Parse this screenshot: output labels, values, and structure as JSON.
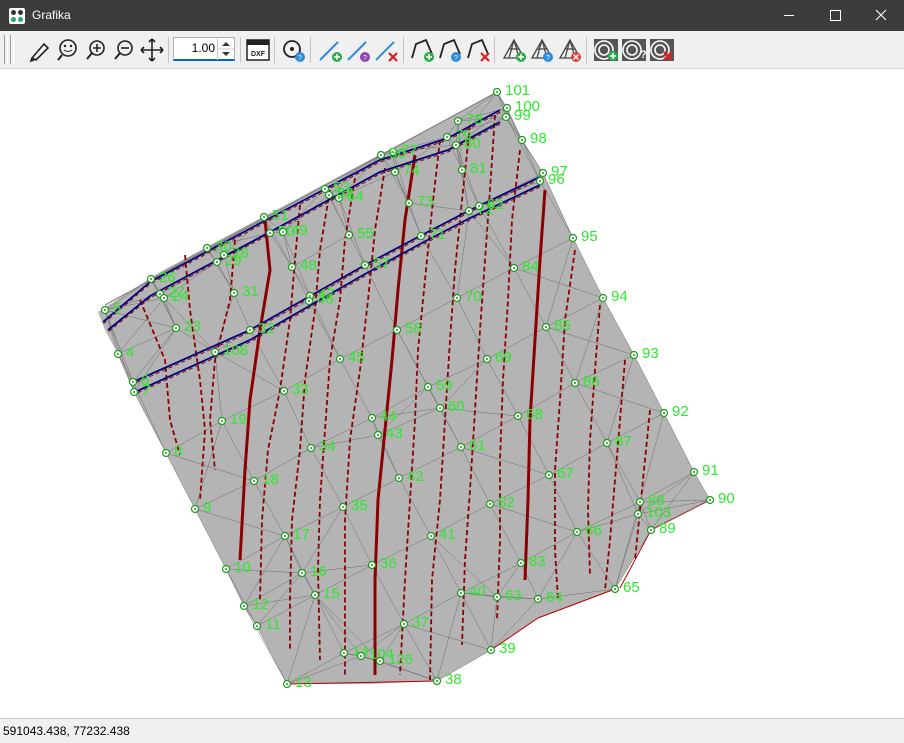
{
  "window": {
    "title": "Grafika"
  },
  "toolbar": {
    "scale_value": "1.00",
    "buttons": [
      {
        "name": "draw-pen-icon"
      },
      {
        "name": "zoom-extents-icon"
      },
      {
        "name": "zoom-in-icon"
      },
      {
        "name": "zoom-out-icon"
      },
      {
        "name": "pan-icon"
      },
      {
        "name": "export-dxf-icon"
      },
      {
        "name": "point-info-icon"
      },
      {
        "name": "add-line-icon"
      },
      {
        "name": "line-info-icon"
      },
      {
        "name": "delete-line-icon"
      },
      {
        "name": "add-polygon-icon"
      },
      {
        "name": "polygon-info-icon"
      },
      {
        "name": "delete-polygon-icon"
      },
      {
        "name": "add-triangulation-icon"
      },
      {
        "name": "triangulation-info-icon"
      },
      {
        "name": "delete-triangulation-icon"
      },
      {
        "name": "add-contours-icon"
      },
      {
        "name": "contours-info-icon"
      },
      {
        "name": "delete-contours-icon"
      }
    ],
    "dxf_label": "DXF"
  },
  "colors": {
    "surface": "#b4b4b4",
    "contour": "#8b0000",
    "breakline": "#00007f",
    "points": "#2ee82e"
  },
  "points": [
    {
      "id": "101"
    },
    {
      "id": "100"
    },
    {
      "id": "99"
    },
    {
      "id": "98"
    },
    {
      "id": "97"
    },
    {
      "id": "96"
    },
    {
      "id": "95"
    },
    {
      "id": "94"
    },
    {
      "id": "93"
    },
    {
      "id": "92"
    },
    {
      "id": "91"
    },
    {
      "id": "90"
    },
    {
      "id": "89"
    },
    {
      "id": "88"
    },
    {
      "id": "103"
    },
    {
      "id": "87"
    },
    {
      "id": "86"
    },
    {
      "id": "85"
    },
    {
      "id": "84"
    },
    {
      "id": "83"
    },
    {
      "id": "82"
    },
    {
      "id": "81"
    },
    {
      "id": "80"
    },
    {
      "id": "79"
    },
    {
      "id": "78"
    },
    {
      "id": "77"
    },
    {
      "id": "74"
    },
    {
      "id": "73"
    },
    {
      "id": "72"
    },
    {
      "id": "71"
    },
    {
      "id": "70"
    },
    {
      "id": "69"
    },
    {
      "id": "68"
    },
    {
      "id": "67"
    },
    {
      "id": "66"
    },
    {
      "id": "65"
    },
    {
      "id": "64"
    },
    {
      "id": "63"
    },
    {
      "id": "62"
    },
    {
      "id": "61"
    },
    {
      "id": "60"
    },
    {
      "id": "59"
    },
    {
      "id": "58"
    },
    {
      "id": "57"
    },
    {
      "id": "56"
    },
    {
      "id": "55"
    },
    {
      "id": "54"
    },
    {
      "id": "53"
    },
    {
      "id": "52"
    },
    {
      "id": "51"
    },
    {
      "id": "50"
    },
    {
      "id": "49"
    },
    {
      "id": "48"
    },
    {
      "id": "47"
    },
    {
      "id": "46"
    },
    {
      "id": "45"
    },
    {
      "id": "44"
    },
    {
      "id": "43"
    },
    {
      "id": "42"
    },
    {
      "id": "41"
    },
    {
      "id": "40"
    },
    {
      "id": "39"
    },
    {
      "id": "38"
    },
    {
      "id": "37"
    },
    {
      "id": "36"
    },
    {
      "id": "35"
    },
    {
      "id": "34"
    },
    {
      "id": "33"
    },
    {
      "id": "32"
    },
    {
      "id": "31"
    },
    {
      "id": "30"
    },
    {
      "id": "29"
    },
    {
      "id": "28"
    },
    {
      "id": "27"
    },
    {
      "id": "26"
    },
    {
      "id": "24"
    },
    {
      "id": "23"
    },
    {
      "id": "19"
    },
    {
      "id": "18"
    },
    {
      "id": "17"
    },
    {
      "id": "16"
    },
    {
      "id": "15"
    },
    {
      "id": "14"
    },
    {
      "id": "13"
    },
    {
      "id": "12"
    },
    {
      "id": "11"
    },
    {
      "id": "10"
    },
    {
      "id": "9"
    },
    {
      "id": "8"
    },
    {
      "id": "7"
    },
    {
      "id": "6"
    },
    {
      "id": "5"
    },
    {
      "id": "4"
    },
    {
      "id": "104"
    },
    {
      "id": "126"
    },
    {
      "id": "108"
    }
  ],
  "status": {
    "coordinates": "591043.438, 77232.438"
  }
}
